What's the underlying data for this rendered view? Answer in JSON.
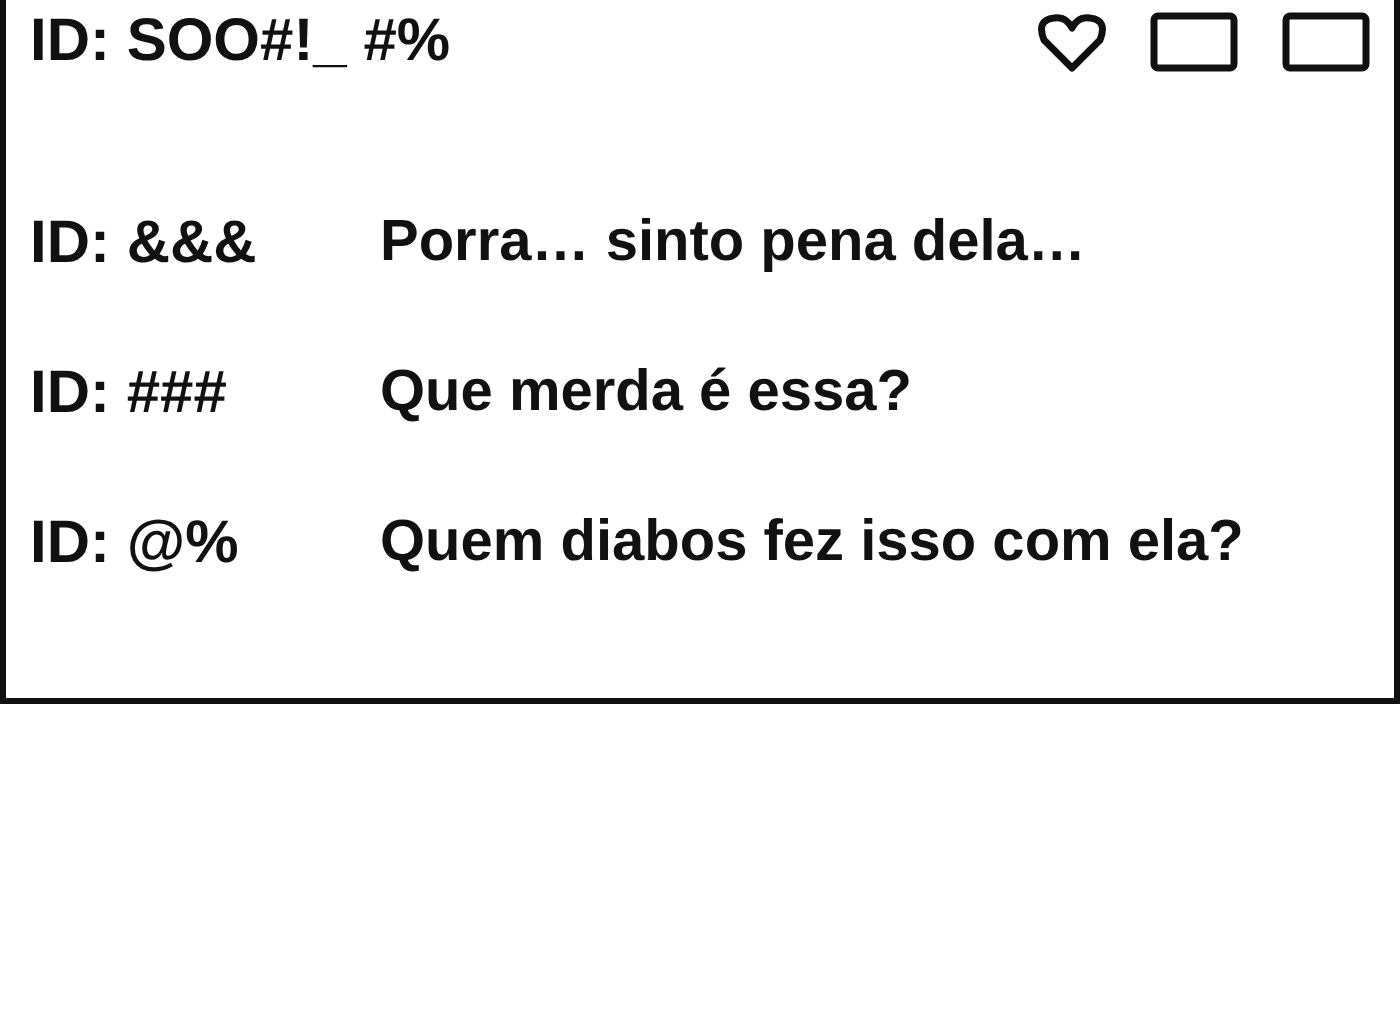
{
  "post": {
    "user_id": "ID: SOO#!_ #%"
  },
  "comments": [
    {
      "user_id": "ID: &&&",
      "text": "Porra… sinto pena dela…"
    },
    {
      "user_id": "ID: ###",
      "text": "Que merda é essa?"
    },
    {
      "user_id": "ID: @%",
      "text": "Quem diabos fez isso com ela?"
    }
  ]
}
